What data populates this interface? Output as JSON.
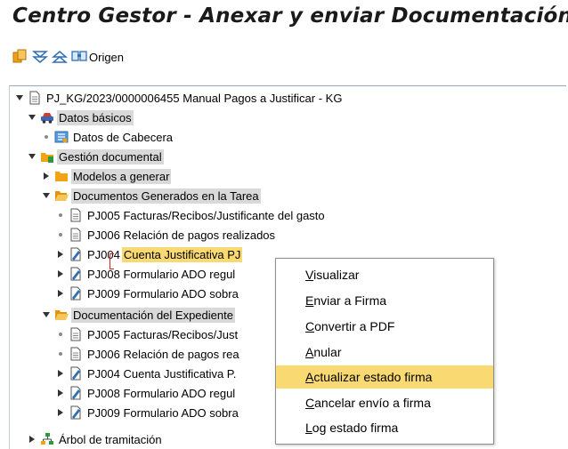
{
  "window": {
    "title": "Centro Gestor - Anexar y enviar Documentación"
  },
  "toolbar": {
    "origin_label": "Origen"
  },
  "tree": {
    "root": "PJ_KG/2023/0000006455 Manual Pagos a Justificar - KG",
    "datos_basicos": "Datos básicos",
    "datos_cabecera": "Datos de Cabecera",
    "gestion_documental": "Gestión documental",
    "modelos_generar": "Modelos a generar",
    "docs_generados": "Documentos Generados en la Tarea",
    "gen_items": [
      "PJ005 Facturas/Recibos/Justificante del gasto",
      "PJ006 Relación de pagos realizados",
      "PJ004",
      "PJ008 Formulario ADO regul",
      "PJ009 Formulario ADO sobra"
    ],
    "gen_pj004_highlight": "Cuenta Justificativa PJ",
    "doc_expediente": "Documentación del Expediente",
    "exp_items": [
      "PJ005 Facturas/Recibos/Just",
      "PJ006 Relación de pagos rea",
      "PJ004 Cuenta Justificativa P.",
      "PJ008 Formulario ADO regul",
      "PJ009 Formulario ADO sobra"
    ],
    "arbol_tramitacion": "Árbol de tramitación"
  },
  "context_menu": {
    "items": [
      "Visualizar",
      "Enviar a Firma",
      "Convertir a PDF",
      "Anular",
      "Actualizar estado firma",
      "Cancelar envío a firma",
      "Log estado firma"
    ],
    "active_index": 4
  },
  "colors": {
    "highlight_yellow": "#f9d972",
    "highlight_grey": "#d9d9d9",
    "folder_orange": "#f2a313",
    "doc_blue": "#2f6fb5"
  }
}
